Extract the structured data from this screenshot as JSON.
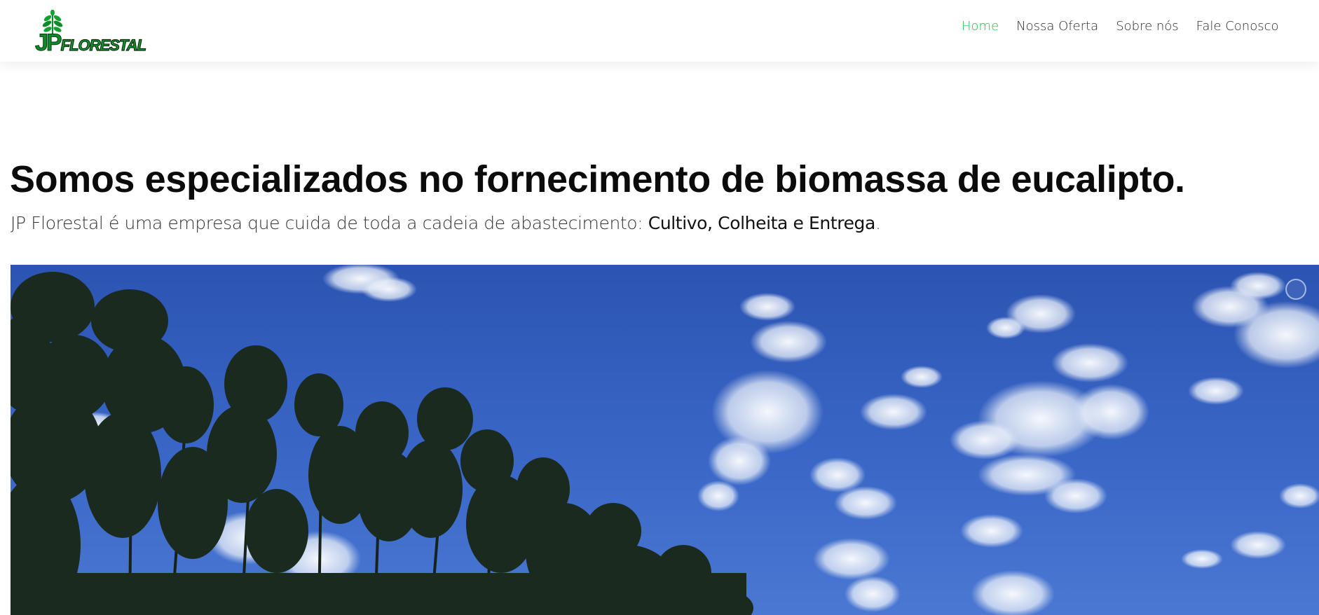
{
  "logo": {
    "mark": "JP",
    "word": "FLORESTAL",
    "icon": "sprout-icon"
  },
  "nav": {
    "items": [
      {
        "label": "Home",
        "active": true
      },
      {
        "label": "Nossa Oferta",
        "active": false
      },
      {
        "label": "Sobre nós",
        "active": false
      },
      {
        "label": "Fale Conosco",
        "active": false
      }
    ],
    "active_color": "#1fbe4c"
  },
  "hero": {
    "title": "Somos especializados no fornecimento de biomassa de eucalipto.",
    "subtitle_prefix": "JP Florestal é uma empresa que cuida de toda a cadeia de abastecimento: ",
    "subtitle_highlight": "Cultivo, Colheita e Entrega",
    "subtitle_suffix": "."
  },
  "colors": {
    "brand_green": "#12a032",
    "sky_blue": "#3a67c7"
  }
}
